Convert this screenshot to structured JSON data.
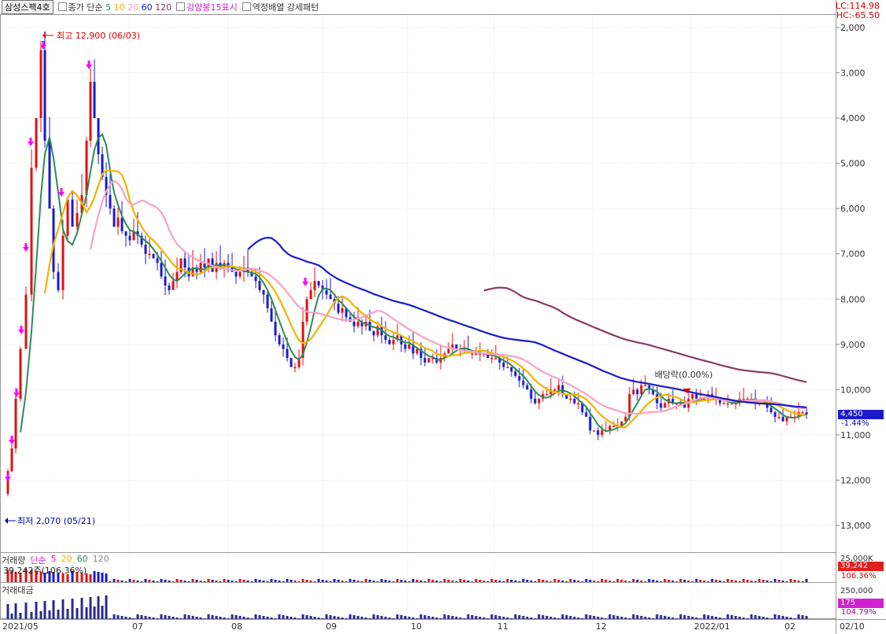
{
  "legend": {
    "stock_name": "삼성스팩4호",
    "price_label": "종가 단순",
    "ma_periods": [
      "5",
      "10",
      "20",
      "60",
      "120"
    ],
    "ma_colors": [
      "#2e8b57",
      "#f0b400",
      "#f4a3c8",
      "#1a1acc",
      "#8b3a62"
    ],
    "strong_candle": "강양봉15표시",
    "pattern": "역정배열 강세패턴"
  },
  "top_right": {
    "lc": "LC:114.98",
    "hc": "HC:-65.50"
  },
  "price_axis": {
    "ticks": [
      "13,000",
      "12,000",
      "11,000",
      "10,000",
      "9,000",
      "8,000",
      "7,000",
      "6,000",
      "5,000",
      "4,000",
      "3,000",
      "2,000"
    ],
    "current_price": "4,450",
    "change_pct": "-1.44%"
  },
  "annotations": {
    "high": "최고 12,900 (06/03)",
    "low": "최저 2,070 (05/21)",
    "dividend": "배당락(0.00%)"
  },
  "volume_panel": {
    "title": "거래량",
    "ma_label": "단순",
    "ma_periods": [
      "5",
      "20",
      "60",
      "120"
    ],
    "summary": "39,242주(106.36%)",
    "axis_top": "25,000K",
    "badge_value": "39,242",
    "badge_pct": "106.36%"
  },
  "amount_panel": {
    "title": "거래대금",
    "axis_top": "250,000",
    "badge_value": "175",
    "badge_pct": "104.79%"
  },
  "x_axis": {
    "labels": [
      "2021/05",
      "07",
      "08",
      "09",
      "10",
      "11",
      "12",
      "2022/01",
      "02",
      "02/10"
    ]
  },
  "chart_data": {
    "type": "candlestick",
    "ylim": [
      1500,
      13200
    ],
    "y_ticks": [
      2000,
      3000,
      4000,
      5000,
      6000,
      7000,
      8000,
      9000,
      10000,
      11000,
      12000,
      13000
    ],
    "x_labels": [
      "2021/05",
      "07",
      "08",
      "09",
      "10",
      "11",
      "12",
      "2022/01",
      "02"
    ],
    "high": 12900,
    "low": 2070,
    "last": 4450
  }
}
